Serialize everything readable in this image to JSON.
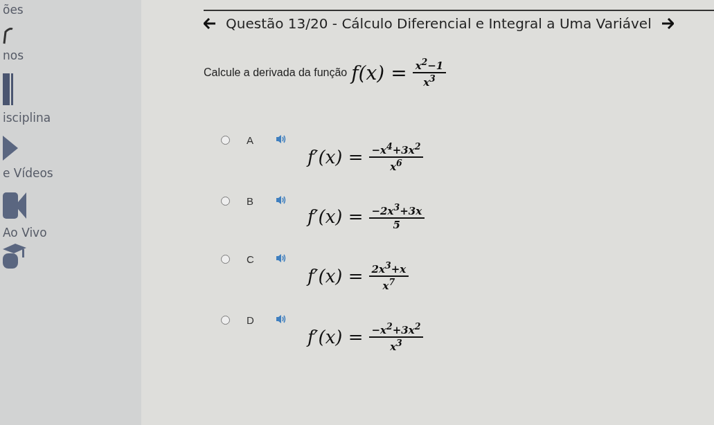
{
  "sidebar": {
    "items": [
      {
        "label": "ões"
      },
      {
        "label": "nos"
      },
      {
        "label": "isciplina"
      },
      {
        "label": "e Vídeos"
      },
      {
        "label": "Ao Vivo"
      }
    ]
  },
  "header": {
    "title": "Questão 13/20 - Cálculo Diferencial e Integral a Uma Variável"
  },
  "question": {
    "text": "Calcule a derivada da função",
    "formula": {
      "lhs": "f(x) =",
      "numerator": "x$^{2}$−1",
      "denominator": "x$^{3}$"
    }
  },
  "options": [
    {
      "letter": "A",
      "selected": false,
      "lhs": "f′(x) =",
      "numerator": "−x$^{4}$+3x$^{2}$",
      "denominator": "x$^{6}$"
    },
    {
      "letter": "B",
      "selected": false,
      "lhs": "f′(x) =",
      "numerator": "−2x$^{3}$+3x",
      "denominator": "5"
    },
    {
      "letter": "C",
      "selected": false,
      "lhs": "f′(x) =",
      "numerator": "2x$^{3}$+x",
      "denominator": "x$^{7}$"
    },
    {
      "letter": "D",
      "selected": false,
      "lhs": "f′(x) =",
      "numerator": "−x$^{2}$+3x$^{2}$",
      "denominator": "x$^{3}$"
    }
  ]
}
